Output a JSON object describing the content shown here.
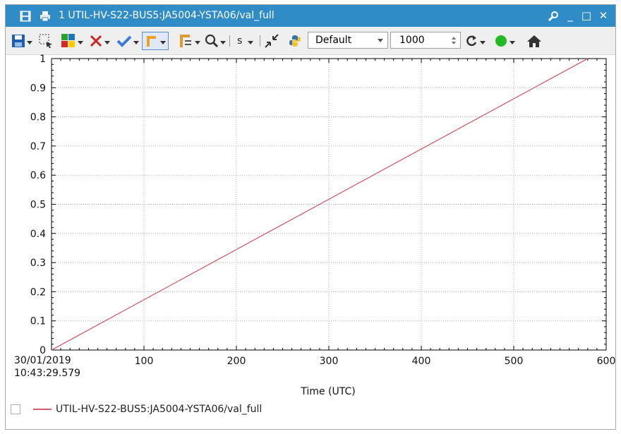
{
  "window": {
    "title": "1 UTIL-HV-S22-BUS5:JA5004-YSTA06/val_full",
    "controls": {
      "settings": "wrench-icon",
      "minimize": "_",
      "maximize": "□",
      "close": "✕"
    }
  },
  "toolbar": {
    "icons": [
      "save-icon",
      "select-region-icon",
      "color-palette-icon",
      "remove-curve-icon",
      "apply-check-icon",
      "cursor-tool-icon",
      "axis-tool-icon",
      "zoom-icon",
      "step-mode-icon",
      "autoscale-icon",
      "python-icon",
      "refresh-icon",
      "status-indicator-icon",
      "home-icon"
    ],
    "scale_label": "s",
    "style_combo": {
      "value": "Default"
    },
    "points_spin": {
      "value": "1000"
    },
    "colors": {
      "save": "#1a5fb4",
      "remove": "#cc2222",
      "check": "#3a7bd5",
      "status": "#22bb22"
    }
  },
  "chart_data": {
    "type": "line",
    "xlabel": "Time (UTC)",
    "ylabel": "",
    "title": "",
    "x_origin_label": [
      "30/01/2019",
      "10:43:29.579"
    ],
    "xlim": [
      0,
      600
    ],
    "ylim": [
      0,
      1
    ],
    "x_ticks": [
      100,
      200,
      300,
      400,
      500,
      600
    ],
    "y_ticks": [
      0,
      0.1,
      0.2,
      0.3,
      0.4,
      0.5,
      0.6,
      0.7,
      0.8,
      0.9,
      1
    ],
    "grid": true,
    "legend": "bottom-left",
    "series": [
      {
        "name": "UTIL-HV-S22-BUS5:JA5004-YSTA06/val_full",
        "color": "#d06070",
        "x": [
          0,
          580
        ],
        "y": [
          0,
          1
        ]
      }
    ]
  }
}
